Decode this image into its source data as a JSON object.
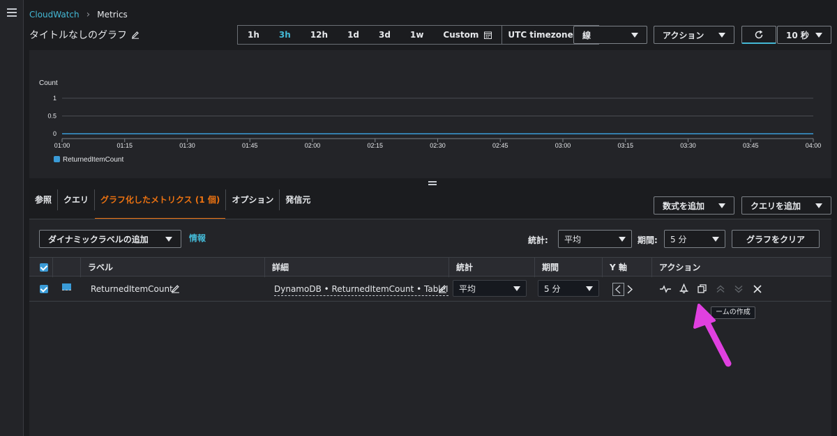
{
  "breadcrumb": {
    "root": "CloudWatch",
    "current": "Metrics"
  },
  "page": {
    "title": "タイトルなしのグラフ"
  },
  "time_range": {
    "options": [
      "1h",
      "3h",
      "12h",
      "1d",
      "3d",
      "1w"
    ],
    "active": "3h",
    "custom_label": "Custom",
    "timezone": "UTC timezone"
  },
  "toolbar": {
    "chart_type": "線",
    "actions_label": "アクション",
    "refresh_interval": "10 秒"
  },
  "chart_data": {
    "type": "line",
    "ylabel": "Count",
    "yticks": [
      "1",
      "0.5",
      "0"
    ],
    "ylim": [
      0,
      1
    ],
    "xticks": [
      "01:00",
      "01:15",
      "01:30",
      "01:45",
      "02:00",
      "02:15",
      "02:30",
      "02:45",
      "03:00",
      "03:15",
      "03:30",
      "03:45",
      "04:00"
    ],
    "series": [
      {
        "name": "ReturnedItemCount",
        "x": [
          "01:00",
          "04:00"
        ],
        "values": [
          0,
          0
        ]
      }
    ],
    "legend": "bottom-left",
    "grid": true
  },
  "tabs": [
    {
      "label": "参照"
    },
    {
      "label": "クエリ"
    },
    {
      "label": "グラフ化したメトリクス (1 個)",
      "active": true
    },
    {
      "label": "オプション"
    },
    {
      "label": "発信元"
    }
  ],
  "buttons": {
    "add_math": "数式を追加",
    "add_query": "クエリを追加",
    "dynamic_label": "ダイナミックラベルの追加",
    "info": "情報",
    "clear_graph": "グラフをクリア"
  },
  "filters": {
    "stat_label": "統計:",
    "stat_value": "平均",
    "period_label": "期間:",
    "period_value": "5 分"
  },
  "table": {
    "headers": [
      "ラベル",
      "詳細",
      "統計",
      "期間",
      "Y 軸",
      "アクション"
    ],
    "rows": [
      {
        "label": "ReturnedItemCount",
        "detail": "DynamoDB • ReturnedItemCount • TableI",
        "stat": "平均",
        "period": "5 分"
      }
    ]
  },
  "tooltip": {
    "text": "ームの作成"
  },
  "colors": {
    "accent": "#44b9d6",
    "active_tab": "#ec7211",
    "series": "#3a9bd7",
    "annotation_arrow": "#e040e0"
  }
}
